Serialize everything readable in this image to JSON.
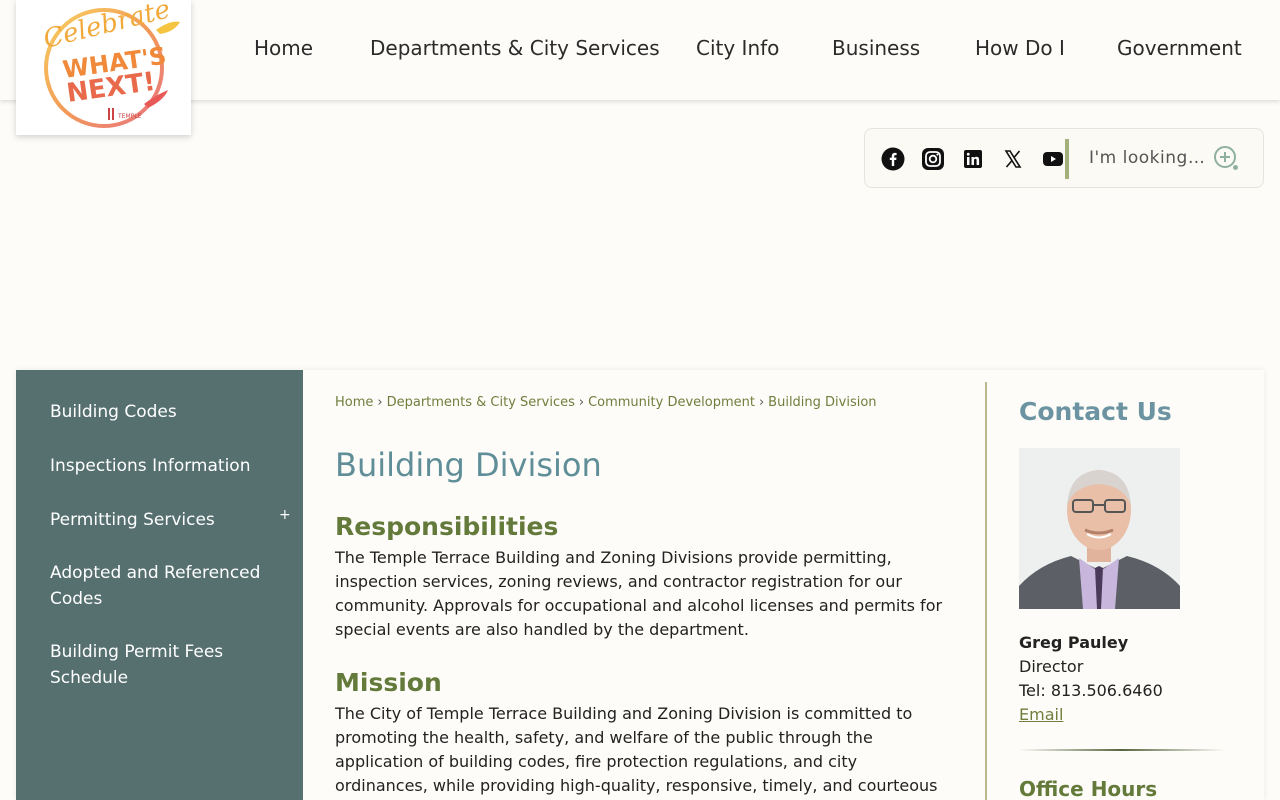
{
  "header": {
    "logo_alt": "Celebrate What's Next! Temple Terrace",
    "nav": [
      {
        "label": "Home"
      },
      {
        "label": "Departments & City Services"
      },
      {
        "label": "City Info"
      },
      {
        "label": "Business"
      },
      {
        "label": "How Do I"
      },
      {
        "label": "Government"
      }
    ]
  },
  "toolbar": {
    "social": [
      "facebook-icon",
      "instagram-icon",
      "linkedin-icon",
      "x-icon",
      "youtube-icon"
    ],
    "search_placeholder": "I'm looking for..."
  },
  "sidebar": {
    "items": [
      {
        "label": "Building Codes"
      },
      {
        "label": "Inspections Information"
      },
      {
        "label": "Permitting Services"
      },
      {
        "label": "Adopted and Referenced Codes"
      },
      {
        "label": "Building Permit Fees Schedule"
      }
    ],
    "expand_symbol": "+"
  },
  "breadcrumb": [
    "Home",
    "Departments & City Services",
    "Community Development",
    "Building Division"
  ],
  "breadcrumb_sep": "›",
  "page_title": "Building Division",
  "sections": [
    {
      "heading": "Responsibilities",
      "text": "The Temple Terrace Building and Zoning Divisions provide permitting, inspection services, zoning reviews, and contractor registration for our community. Approvals for occupational and alcohol licenses and permits for special events are also handled by the department."
    },
    {
      "heading": "Mission",
      "text": "The City of Temple Terrace Building and Zoning Division is committed to promoting the health, safety, and welfare of the public through the application of building codes, fire protection regulations, and city ordinances, while providing high-quality, responsive, timely, and courteous service to our citizens and"
    }
  ],
  "contact": {
    "title": "Contact Us",
    "name": "Greg Pauley",
    "role": "Director",
    "tel": "Tel: 813.506.6460",
    "email_label": "Email",
    "hours_title": "Office Hours"
  },
  "colors": {
    "sidebar_bg": "#566f6f",
    "title_blue": "#5f8e99",
    "heading_green": "#637a3a",
    "link_green": "#6f7e3d"
  }
}
